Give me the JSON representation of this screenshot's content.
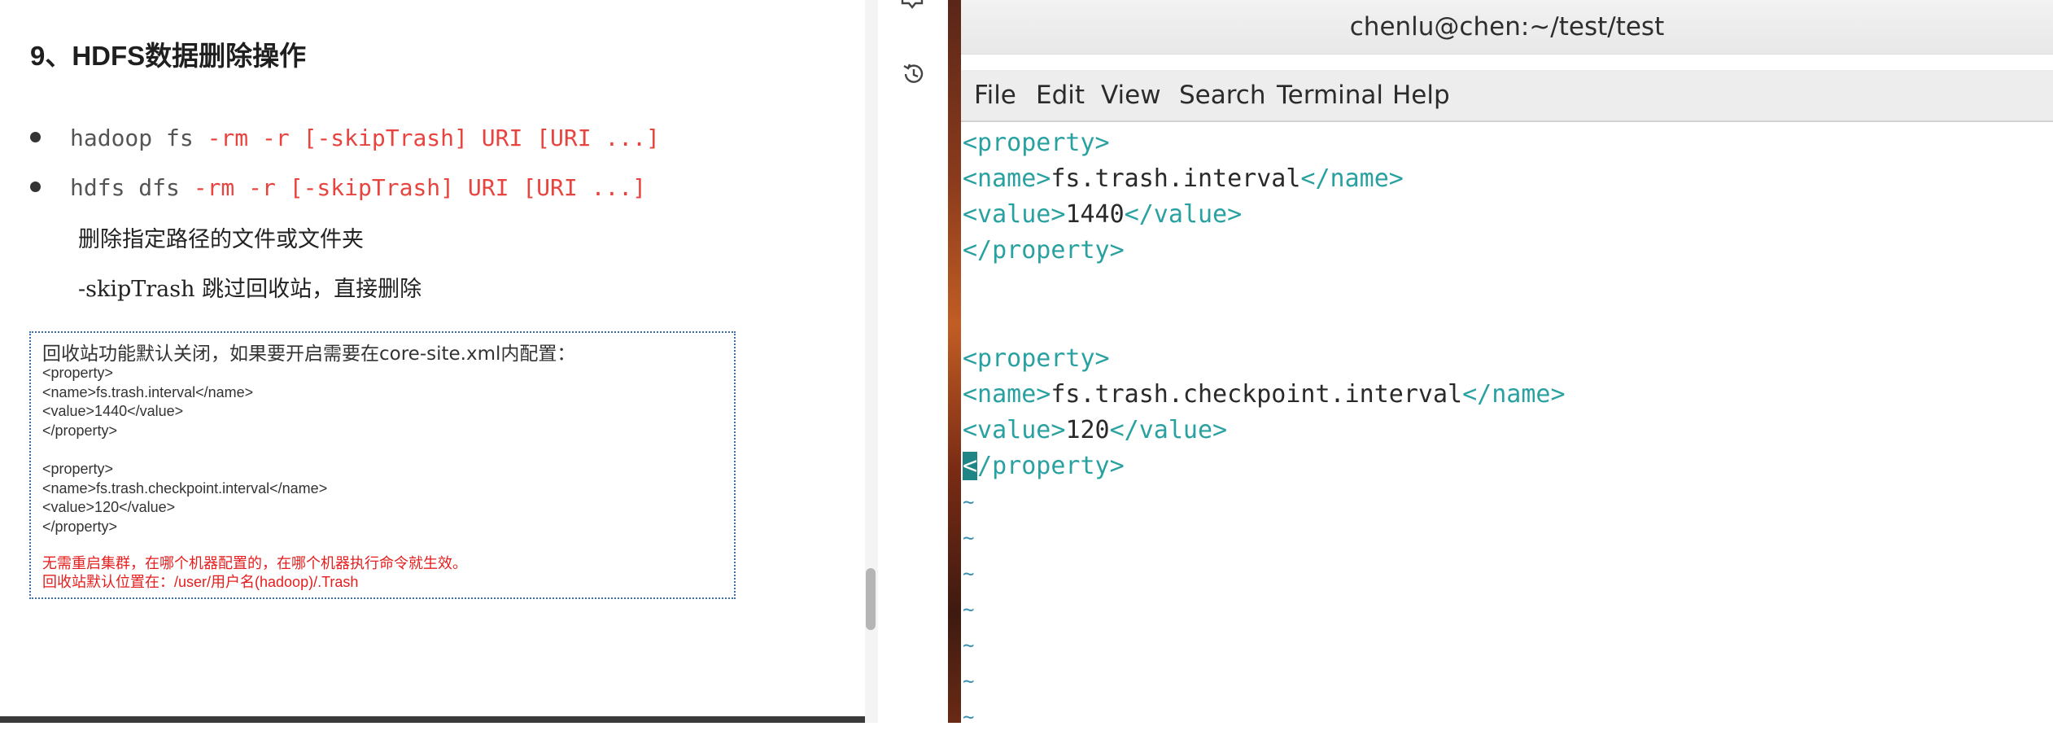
{
  "document": {
    "title": "9、HDFS数据删除操作",
    "commands": [
      {
        "prefix": "hadoop fs ",
        "args": "-rm -r [-skipTrash] URI [URI ...]"
      },
      {
        "prefix": "hdfs dfs ",
        "args": "-rm -r [-skipTrash] URI [URI ...]"
      }
    ],
    "descriptions": [
      "删除指定路径的文件或文件夹",
      "-skipTrash 跳过回收站，直接删除"
    ],
    "note": {
      "heading": "回收站功能默认关闭，如果要开启需要在core-site.xml内配置：",
      "code_lines": [
        "<property>",
        "<name>fs.trash.interval</name>",
        "<value>1440</value>",
        "</property>",
        "",
        "<property>",
        "<name>fs.trash.checkpoint.interval</name>",
        "<value>120</value>",
        "</property>"
      ],
      "red_lines": [
        "无需重启集群，在哪个机器配置的，在哪个机器执行命令就生效。",
        "回收站默认位置在：/user/用户名(hadoop)/.Trash"
      ]
    }
  },
  "side_icons": [
    "comment-icon",
    "history-icon"
  ],
  "terminal": {
    "title": "chenlu@chen:~/test/test",
    "menu": [
      "File",
      "Edit",
      "View",
      "Search",
      "Terminal",
      "Help"
    ],
    "lines": {
      "l1_tag": "<property>",
      "l2_open": "<name>",
      "l2_text": "fs.trash.interval",
      "l2_close": "</name>",
      "l3_open": "<value>",
      "l3_text": "1440",
      "l3_close": "</value>",
      "l4_tag": "</property>",
      "l5_tag": "<property>",
      "l6_open": "<name>",
      "l6_text": "fs.trash.checkpoint.interval",
      "l6_close": "</name>",
      "l7_open": "<value>",
      "l7_text": "120",
      "l7_close": "</value>",
      "l8_cursor": "<",
      "l8_rest": "/property>",
      "tilde": "~"
    },
    "colors": {
      "tag": "#2aa1a1",
      "cursor": "#1f8585"
    }
  }
}
